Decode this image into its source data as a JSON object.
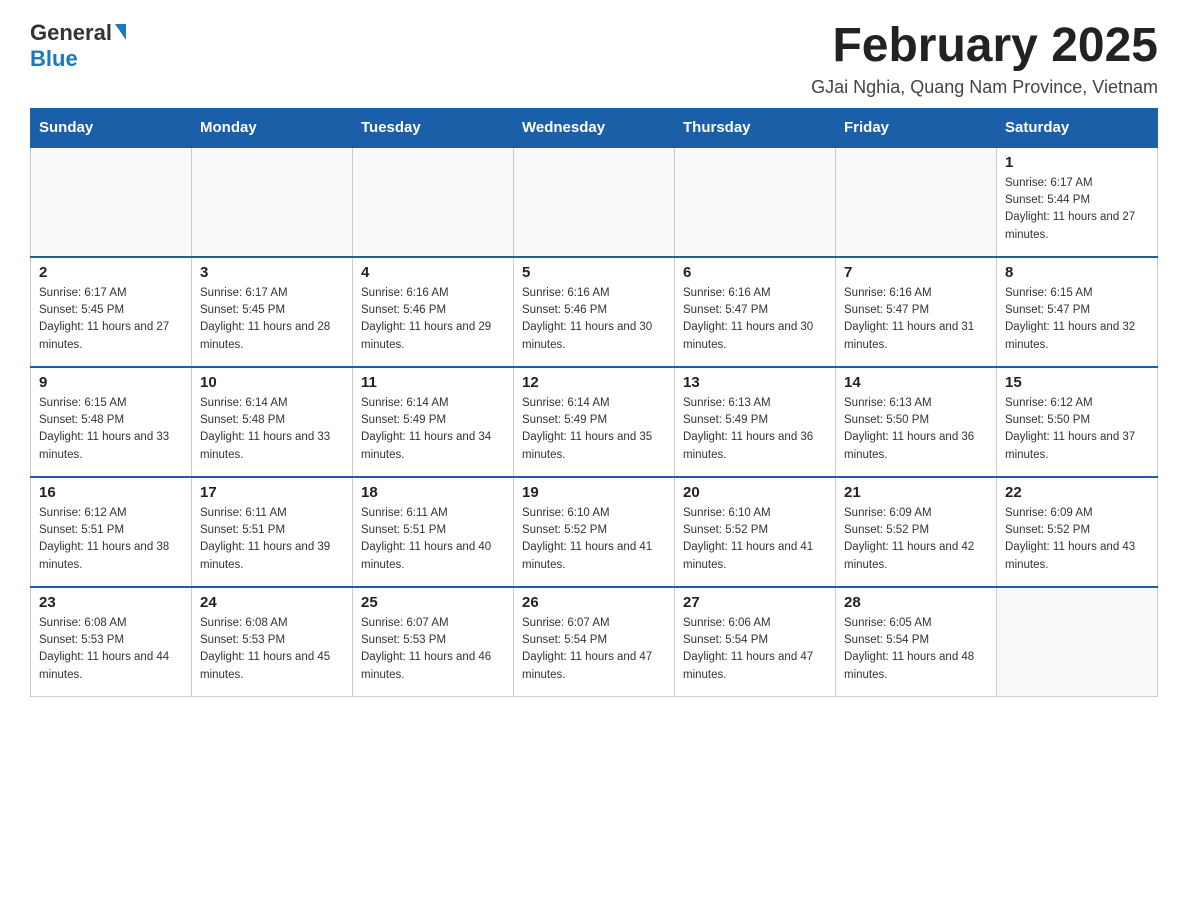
{
  "header": {
    "logo_general": "General",
    "logo_blue": "Blue",
    "month_title": "February 2025",
    "location": "GJai Nghia, Quang Nam Province, Vietnam"
  },
  "weekdays": [
    "Sunday",
    "Monday",
    "Tuesday",
    "Wednesday",
    "Thursday",
    "Friday",
    "Saturday"
  ],
  "weeks": [
    [
      {
        "day": "",
        "info": ""
      },
      {
        "day": "",
        "info": ""
      },
      {
        "day": "",
        "info": ""
      },
      {
        "day": "",
        "info": ""
      },
      {
        "day": "",
        "info": ""
      },
      {
        "day": "",
        "info": ""
      },
      {
        "day": "1",
        "info": "Sunrise: 6:17 AM\nSunset: 5:44 PM\nDaylight: 11 hours and 27 minutes."
      }
    ],
    [
      {
        "day": "2",
        "info": "Sunrise: 6:17 AM\nSunset: 5:45 PM\nDaylight: 11 hours and 27 minutes."
      },
      {
        "day": "3",
        "info": "Sunrise: 6:17 AM\nSunset: 5:45 PM\nDaylight: 11 hours and 28 minutes."
      },
      {
        "day": "4",
        "info": "Sunrise: 6:16 AM\nSunset: 5:46 PM\nDaylight: 11 hours and 29 minutes."
      },
      {
        "day": "5",
        "info": "Sunrise: 6:16 AM\nSunset: 5:46 PM\nDaylight: 11 hours and 30 minutes."
      },
      {
        "day": "6",
        "info": "Sunrise: 6:16 AM\nSunset: 5:47 PM\nDaylight: 11 hours and 30 minutes."
      },
      {
        "day": "7",
        "info": "Sunrise: 6:16 AM\nSunset: 5:47 PM\nDaylight: 11 hours and 31 minutes."
      },
      {
        "day": "8",
        "info": "Sunrise: 6:15 AM\nSunset: 5:47 PM\nDaylight: 11 hours and 32 minutes."
      }
    ],
    [
      {
        "day": "9",
        "info": "Sunrise: 6:15 AM\nSunset: 5:48 PM\nDaylight: 11 hours and 33 minutes."
      },
      {
        "day": "10",
        "info": "Sunrise: 6:14 AM\nSunset: 5:48 PM\nDaylight: 11 hours and 33 minutes."
      },
      {
        "day": "11",
        "info": "Sunrise: 6:14 AM\nSunset: 5:49 PM\nDaylight: 11 hours and 34 minutes."
      },
      {
        "day": "12",
        "info": "Sunrise: 6:14 AM\nSunset: 5:49 PM\nDaylight: 11 hours and 35 minutes."
      },
      {
        "day": "13",
        "info": "Sunrise: 6:13 AM\nSunset: 5:49 PM\nDaylight: 11 hours and 36 minutes."
      },
      {
        "day": "14",
        "info": "Sunrise: 6:13 AM\nSunset: 5:50 PM\nDaylight: 11 hours and 36 minutes."
      },
      {
        "day": "15",
        "info": "Sunrise: 6:12 AM\nSunset: 5:50 PM\nDaylight: 11 hours and 37 minutes."
      }
    ],
    [
      {
        "day": "16",
        "info": "Sunrise: 6:12 AM\nSunset: 5:51 PM\nDaylight: 11 hours and 38 minutes."
      },
      {
        "day": "17",
        "info": "Sunrise: 6:11 AM\nSunset: 5:51 PM\nDaylight: 11 hours and 39 minutes."
      },
      {
        "day": "18",
        "info": "Sunrise: 6:11 AM\nSunset: 5:51 PM\nDaylight: 11 hours and 40 minutes."
      },
      {
        "day": "19",
        "info": "Sunrise: 6:10 AM\nSunset: 5:52 PM\nDaylight: 11 hours and 41 minutes."
      },
      {
        "day": "20",
        "info": "Sunrise: 6:10 AM\nSunset: 5:52 PM\nDaylight: 11 hours and 41 minutes."
      },
      {
        "day": "21",
        "info": "Sunrise: 6:09 AM\nSunset: 5:52 PM\nDaylight: 11 hours and 42 minutes."
      },
      {
        "day": "22",
        "info": "Sunrise: 6:09 AM\nSunset: 5:52 PM\nDaylight: 11 hours and 43 minutes."
      }
    ],
    [
      {
        "day": "23",
        "info": "Sunrise: 6:08 AM\nSunset: 5:53 PM\nDaylight: 11 hours and 44 minutes."
      },
      {
        "day": "24",
        "info": "Sunrise: 6:08 AM\nSunset: 5:53 PM\nDaylight: 11 hours and 45 minutes."
      },
      {
        "day": "25",
        "info": "Sunrise: 6:07 AM\nSunset: 5:53 PM\nDaylight: 11 hours and 46 minutes."
      },
      {
        "day": "26",
        "info": "Sunrise: 6:07 AM\nSunset: 5:54 PM\nDaylight: 11 hours and 47 minutes."
      },
      {
        "day": "27",
        "info": "Sunrise: 6:06 AM\nSunset: 5:54 PM\nDaylight: 11 hours and 47 minutes."
      },
      {
        "day": "28",
        "info": "Sunrise: 6:05 AM\nSunset: 5:54 PM\nDaylight: 11 hours and 48 minutes."
      },
      {
        "day": "",
        "info": ""
      }
    ]
  ]
}
